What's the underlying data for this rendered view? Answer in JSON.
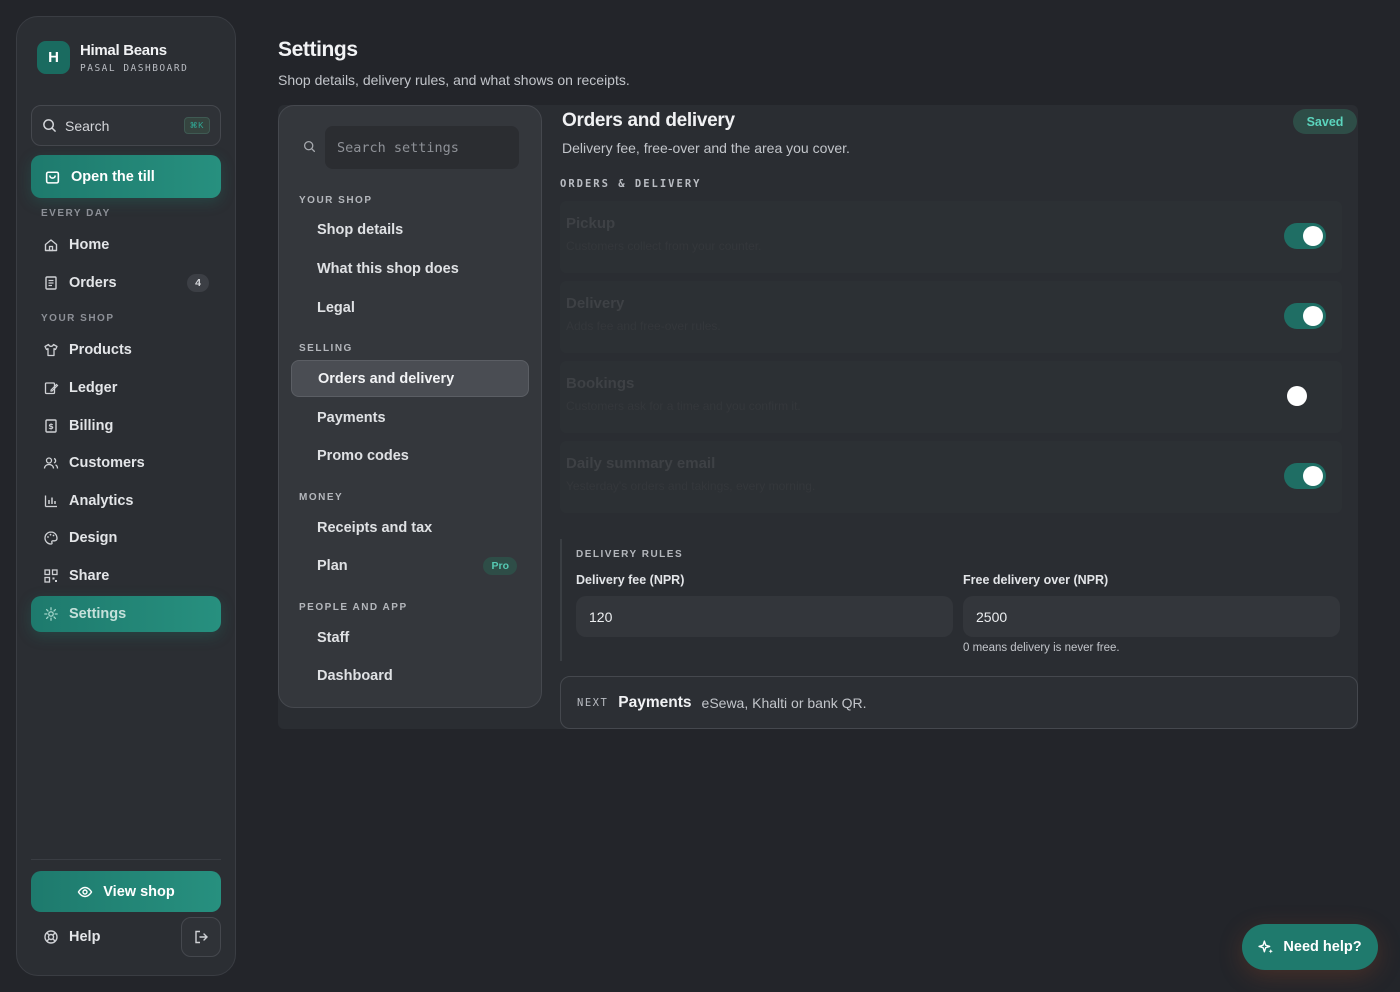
{
  "brand": {
    "logo_letter": "H",
    "name": "Himal Beans",
    "subtitle": "PASAL DASHBOARD"
  },
  "sidebar": {
    "search_label": "Search",
    "search_shortcut": "⌘K",
    "till_button": "Open the till",
    "section_every_day": "EVERY DAY",
    "section_your_shop": "YOUR SHOP",
    "items": [
      {
        "label": "Home",
        "icon": "home-icon"
      },
      {
        "label": "Orders",
        "icon": "receipt-icon",
        "count": "4"
      },
      {
        "label": "Products",
        "icon": "shirt-icon"
      },
      {
        "label": "Ledger",
        "icon": "edit-icon"
      },
      {
        "label": "Billing",
        "icon": "bill-icon"
      },
      {
        "label": "Customers",
        "icon": "users-icon"
      },
      {
        "label": "Analytics",
        "icon": "chart-icon"
      },
      {
        "label": "Design",
        "icon": "palette-icon"
      },
      {
        "label": "Share",
        "icon": "qr-icon"
      },
      {
        "label": "Settings",
        "icon": "gear-icon",
        "active": true
      }
    ],
    "view_shop_button": "View shop",
    "help_label": "Help"
  },
  "header": {
    "title": "Settings",
    "subtitle": "Shop details, delivery rules, and what shows on receipts."
  },
  "settings_nav": {
    "search_placeholder": "Search settings",
    "sections": [
      {
        "label": "YOUR SHOP",
        "items": [
          "Shop details",
          "What this shop does",
          "Legal"
        ]
      },
      {
        "label": "SELLING",
        "items": [
          "Orders and delivery",
          "Payments",
          "Promo codes"
        ]
      },
      {
        "label": "MONEY",
        "items": [
          "Receipts and tax",
          "Plan"
        ]
      },
      {
        "label": "PEOPLE AND APP",
        "items": [
          "Staff",
          "Dashboard"
        ]
      }
    ],
    "active_item": "Orders and delivery",
    "plan_badge": "Pro"
  },
  "panel": {
    "title": "Orders and delivery",
    "subtitle": "Delivery fee, free-over and the area you cover.",
    "status_badge": "Saved",
    "section_heading": "ORDERS & DELIVERY",
    "toggles": [
      {
        "title": "Pickup",
        "desc": "Customers collect from your counter.",
        "on": true
      },
      {
        "title": "Delivery",
        "desc": "Adds fee and free-over rules.",
        "on": true
      },
      {
        "title": "Bookings",
        "desc": "Customers ask for a time and you confirm it.",
        "on": false
      },
      {
        "title": "Daily summary email",
        "desc": "Yesterday's orders and takings, every morning.",
        "on": true
      }
    ],
    "delivery_rules": {
      "heading": "DELIVERY RULES",
      "fee_label": "Delivery fee (NPR)",
      "fee_value": "120",
      "free_over_label": "Free delivery over (NPR)",
      "free_over_value": "2500",
      "hint": "0 means delivery is never free."
    },
    "next": {
      "tag": "NEXT",
      "title": "Payments",
      "desc": "eSewa, Khalti or bank QR."
    }
  },
  "help_fab": "Need help?",
  "colors": {
    "accent": "#1f7a6d",
    "accent_light": "#5bd4bd",
    "background": "#23252a",
    "panel": "#34373c"
  }
}
